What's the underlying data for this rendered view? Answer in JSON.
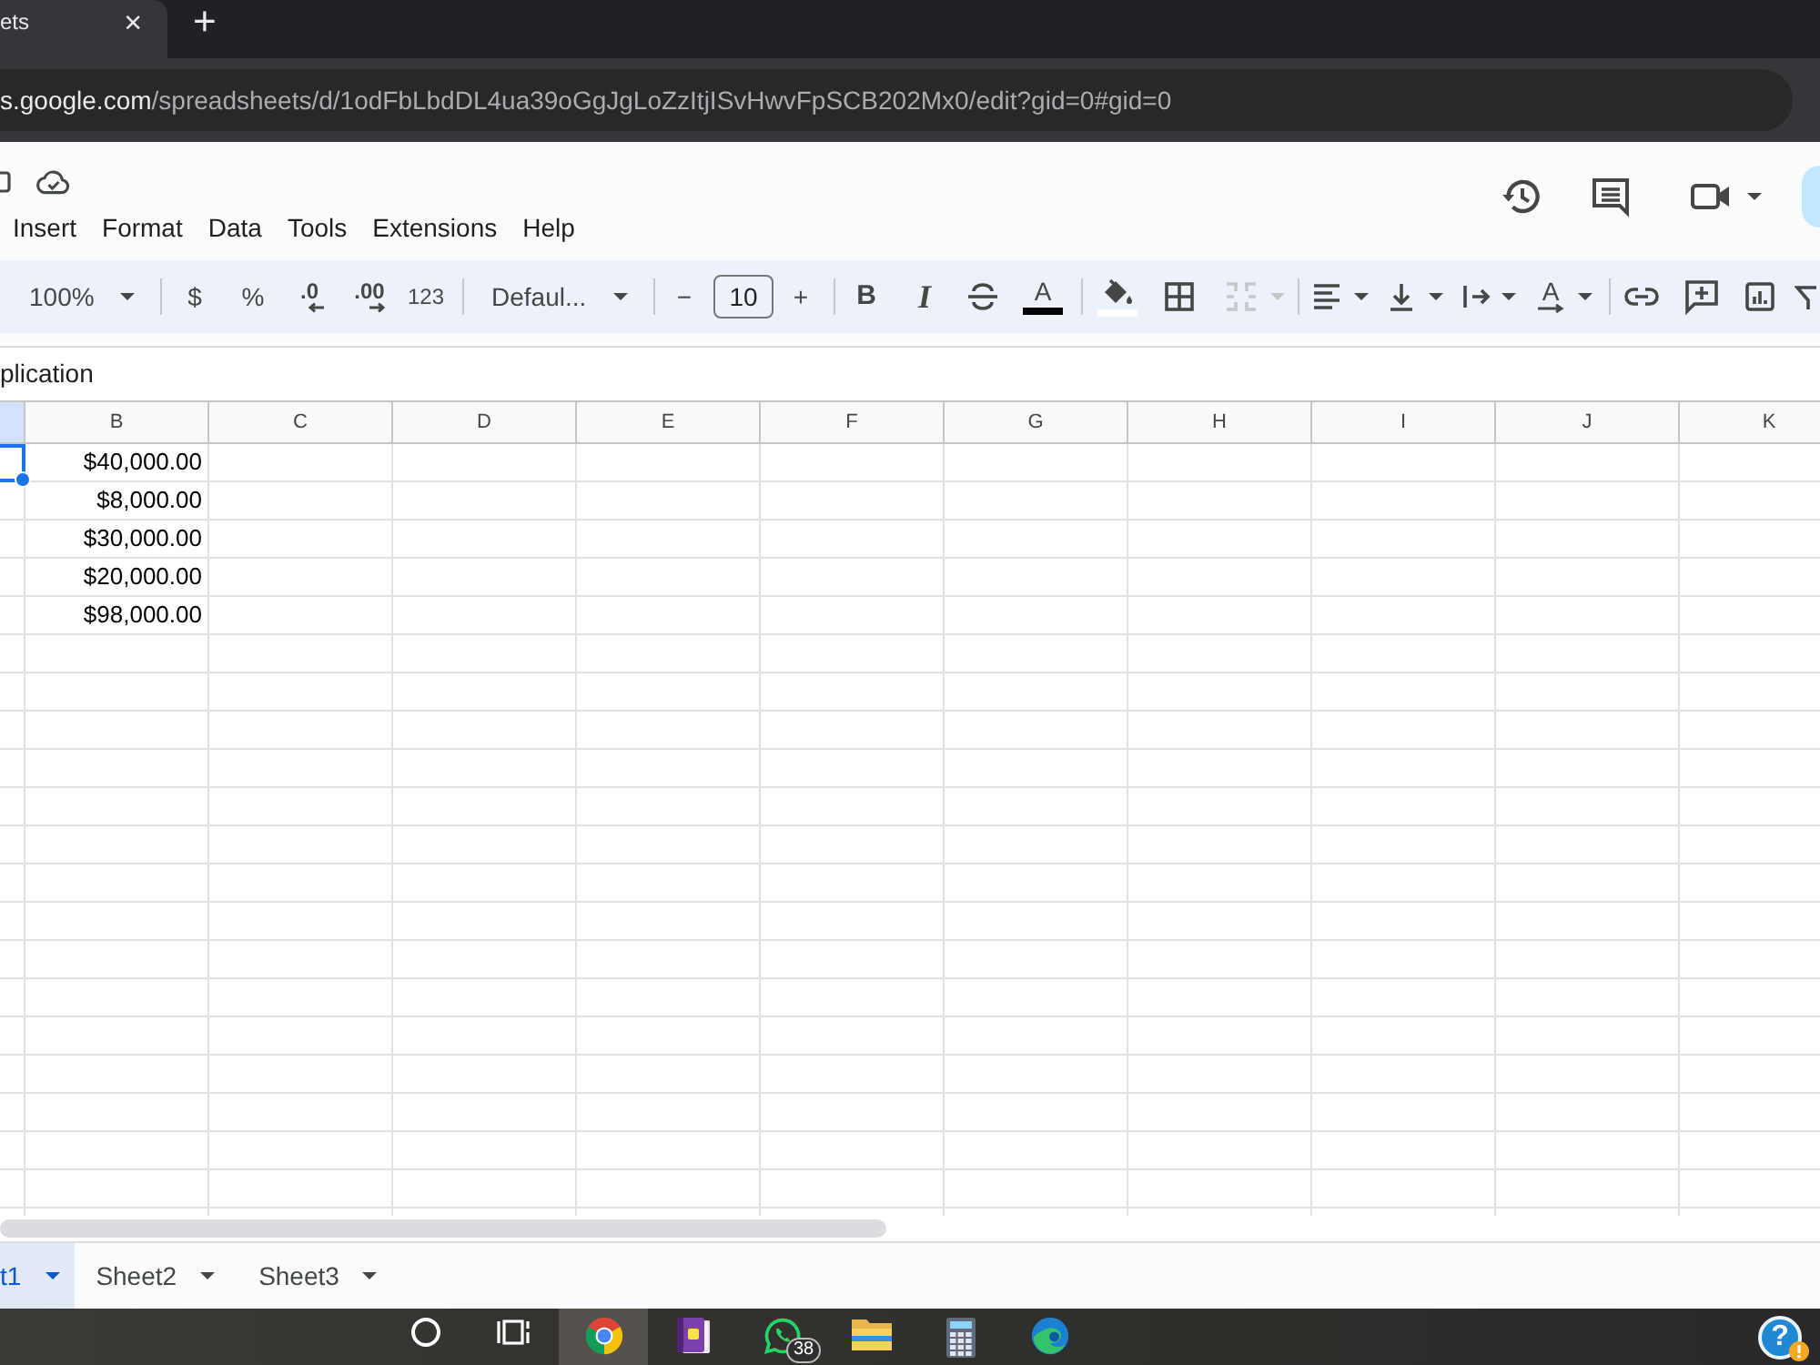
{
  "browser": {
    "tab": {
      "title": "ets",
      "close": "×",
      "selected": true
    },
    "new_tab": "+",
    "address": {
      "host": "s.google.com",
      "path": "/spreadsheets/d/1odFbLbdDL4ua39oGgJgLoZzItjISvHwvFpSCB202Mx0/edit?gid=0#gid=0"
    }
  },
  "menu": [
    "Insert",
    "Format",
    "Data",
    "Tools",
    "Extensions",
    "Help"
  ],
  "toolbar": {
    "zoom": "100%",
    "currency": "$",
    "percent": "%",
    "decrease_decimals": ".0",
    "increase_decimals": ".00",
    "number_format": "123",
    "font": "Defaul...",
    "size_minus": "−",
    "font_size": "10",
    "size_plus": "+",
    "bold": "B",
    "italic": "I",
    "text_color": {
      "label": "A",
      "color": "#000000"
    },
    "fill_color": {
      "color": "#ffffff"
    },
    "merge": {
      "disabled": true
    },
    "rotate": "A"
  },
  "formula_bar": {
    "value": "plication"
  },
  "grid": {
    "partial_column": {
      "selected": true
    },
    "columns": [
      "B",
      "C",
      "D",
      "E",
      "F",
      "G",
      "H",
      "I",
      "J",
      "K"
    ],
    "rows": [
      {
        "selected": true,
        "cells": [
          "$40,000.00"
        ]
      },
      {
        "selected": false,
        "cells": [
          "$8,000.00"
        ]
      },
      {
        "selected": false,
        "cells": [
          "$30,000.00"
        ]
      },
      {
        "selected": false,
        "cells": [
          "$20,000.00"
        ]
      },
      {
        "selected": false,
        "cells": [
          "$98,000.00"
        ]
      }
    ]
  },
  "sheet_tabs": [
    {
      "label": "t1",
      "selected": true
    },
    {
      "label": "Sheet2",
      "selected": false
    },
    {
      "label": "Sheet3",
      "selected": false
    }
  ],
  "taskbar": {
    "items": [
      {
        "kind": "ring",
        "active": false
      },
      {
        "kind": "panes",
        "active": false
      },
      {
        "kind": "wheel",
        "active": true
      },
      {
        "kind": "book",
        "active": false
      },
      {
        "kind": "chat",
        "active": false,
        "badge": "38"
      },
      {
        "kind": "folder",
        "active": false
      },
      {
        "kind": "calculator",
        "active": false
      },
      {
        "kind": "swirl",
        "active": false
      }
    ],
    "help": "?"
  }
}
